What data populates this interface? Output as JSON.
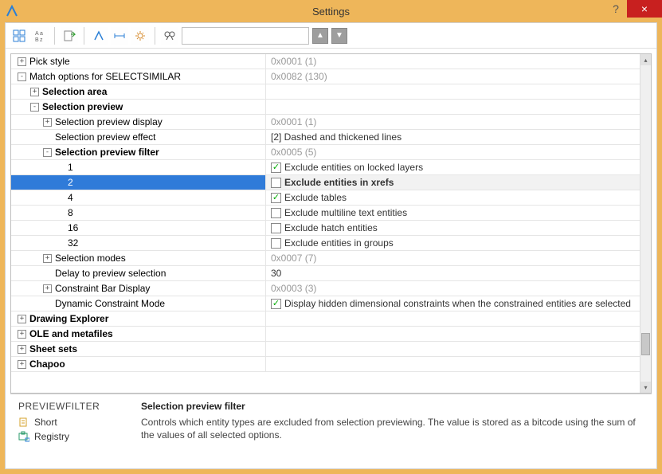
{
  "window": {
    "title": "Settings",
    "help": "?",
    "close": "×"
  },
  "search": {
    "placeholder": ""
  },
  "rows": [
    {
      "indent": 0,
      "exp": "+",
      "label": "Pick style",
      "value": "0x0001 (1)",
      "grey": true
    },
    {
      "indent": 0,
      "exp": "-",
      "label": "Match options for SELECTSIMILAR",
      "value": "0x0082 (130)",
      "grey": true
    },
    {
      "indent": 1,
      "exp": "+",
      "label": "Selection area",
      "bold": true,
      "value": ""
    },
    {
      "indent": 1,
      "exp": "-",
      "label": "Selection preview",
      "bold": true,
      "value": ""
    },
    {
      "indent": 2,
      "exp": "+",
      "label": "Selection preview display",
      "value": "0x0001 (1)",
      "grey": true
    },
    {
      "indent": 2,
      "exp": "",
      "label": "Selection preview effect",
      "value": "[2] Dashed and thickened lines"
    },
    {
      "indent": 2,
      "exp": "-",
      "label": "Selection preview filter",
      "bold": true,
      "value": "0x0005 (5)",
      "grey": true
    },
    {
      "indent": 3,
      "exp": "",
      "label": "1",
      "check": true,
      "clabel": "Exclude entities on locked layers"
    },
    {
      "indent": 3,
      "exp": "",
      "label": "2",
      "sel": true,
      "check": false,
      "clabel": "Exclude entities in xrefs"
    },
    {
      "indent": 3,
      "exp": "",
      "label": "4",
      "check": true,
      "clabel": "Exclude tables"
    },
    {
      "indent": 3,
      "exp": "",
      "label": "8",
      "check": false,
      "clabel": "Exclude multiline text entities"
    },
    {
      "indent": 3,
      "exp": "",
      "label": "16",
      "check": false,
      "clabel": "Exclude hatch entities"
    },
    {
      "indent": 3,
      "exp": "",
      "label": "32",
      "check": false,
      "clabel": "Exclude entities in groups"
    },
    {
      "indent": 2,
      "exp": "+",
      "label": "Selection modes",
      "value": "0x0007 (7)",
      "grey": true
    },
    {
      "indent": 2,
      "exp": "",
      "label": "Delay to preview selection",
      "value": "30"
    },
    {
      "indent": 2,
      "exp": "+",
      "label": "Constraint Bar Display",
      "value": "0x0003 (3)",
      "grey": true
    },
    {
      "indent": 2,
      "exp": "",
      "label": "Dynamic Constraint Mode",
      "check": true,
      "clabel": "Display hidden dimensional constraints when the constrained entities are selected"
    },
    {
      "indent": 0,
      "exp": "+",
      "label": "Drawing Explorer",
      "bold": true,
      "value": ""
    },
    {
      "indent": 0,
      "exp": "+",
      "label": "OLE and metafiles",
      "bold": true,
      "value": ""
    },
    {
      "indent": 0,
      "exp": "+",
      "label": "Sheet sets",
      "bold": true,
      "value": ""
    },
    {
      "indent": 0,
      "exp": "+",
      "label": "Chapoo",
      "bold": true,
      "value": ""
    }
  ],
  "info": {
    "sysvar": "PREVIEWFILTER",
    "flag1": "Short",
    "flag2": "Registry",
    "title": "Selection preview filter",
    "desc": "Controls which entity types are excluded from selection previewing. The value is stored as a bitcode using the sum of the values of all selected options."
  }
}
